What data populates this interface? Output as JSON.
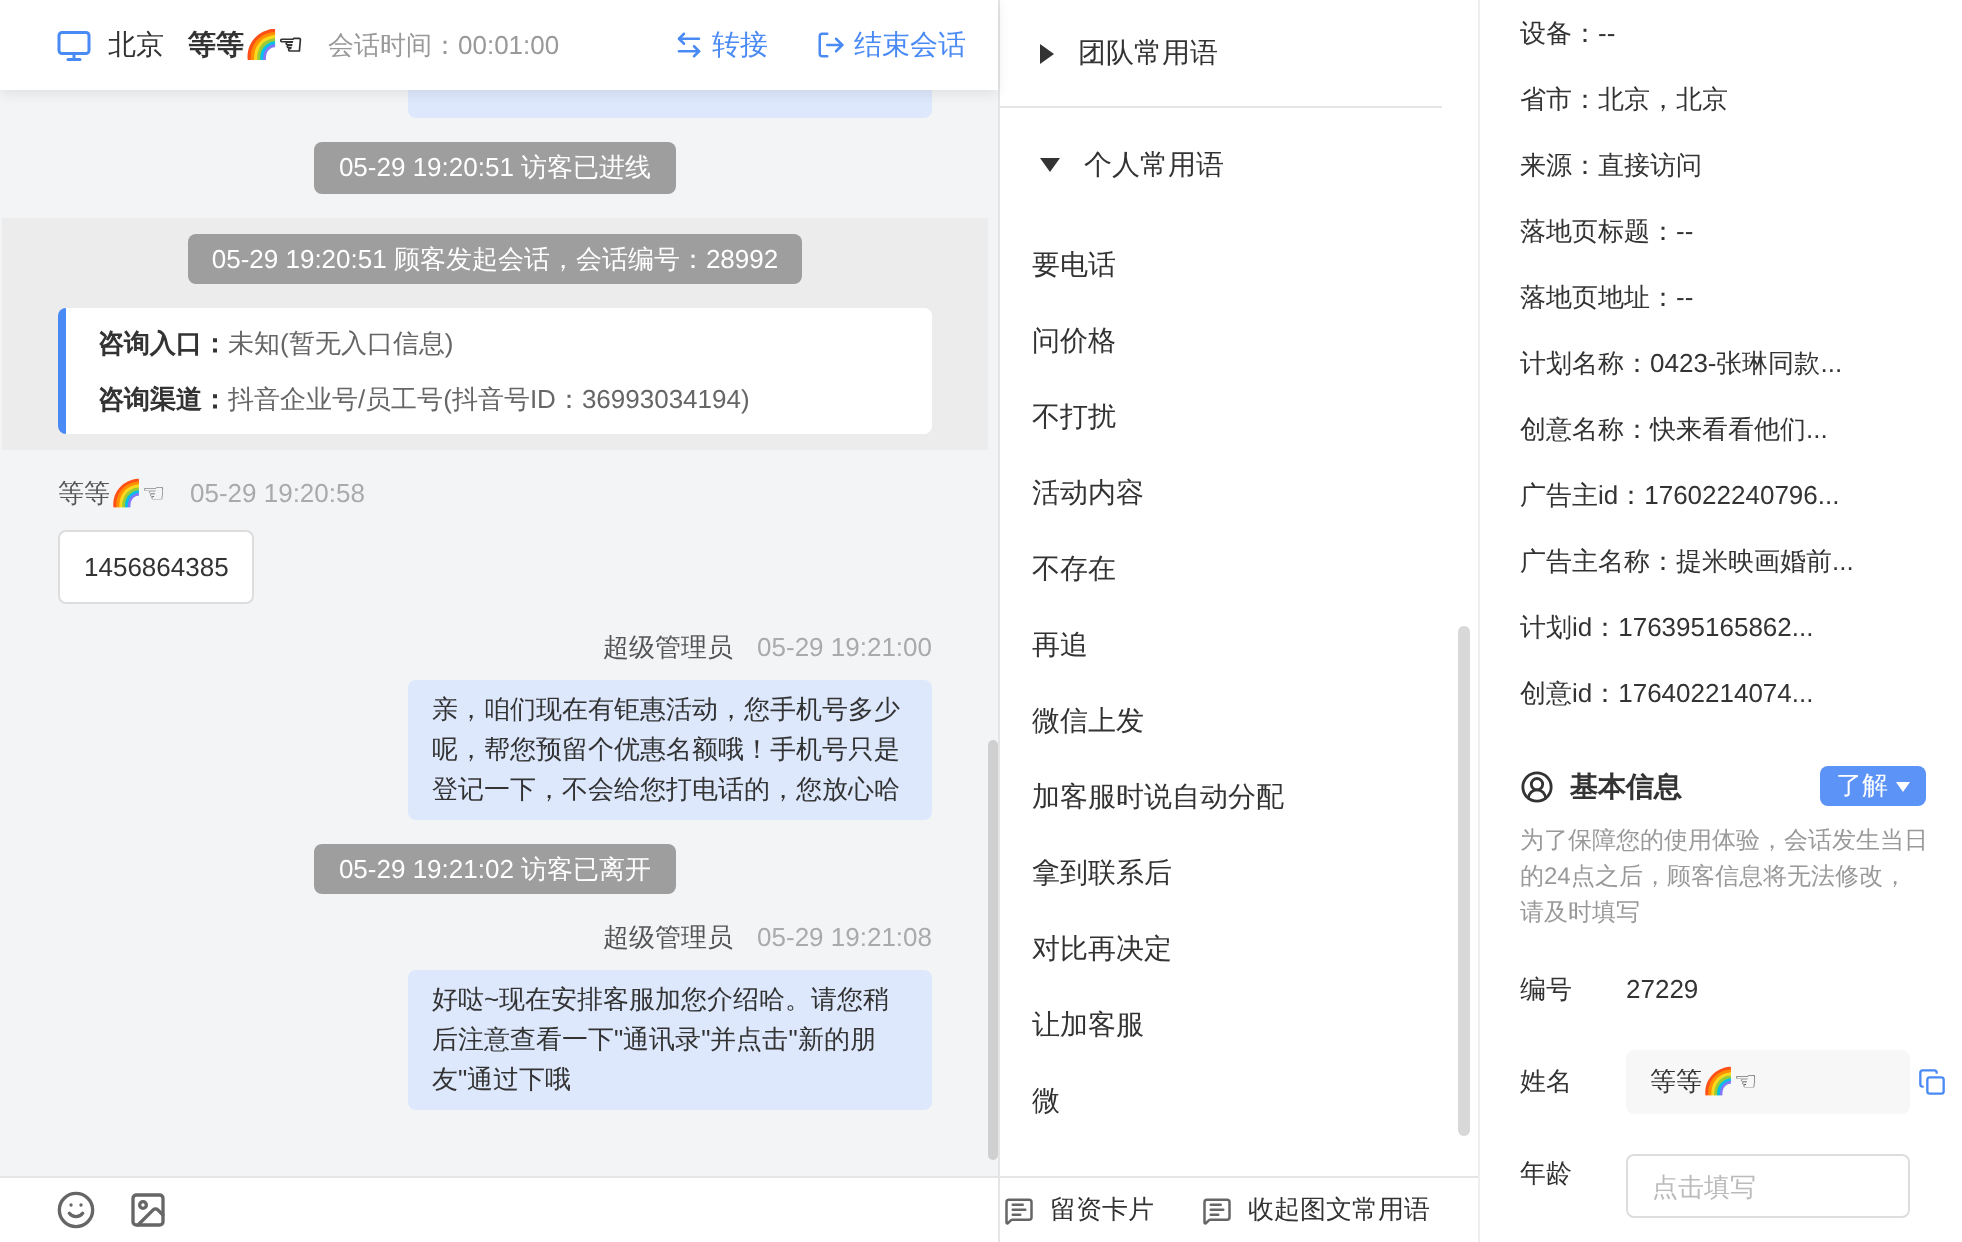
{
  "header": {
    "location": "北京",
    "visitor": "等等🌈☜",
    "duration": "会话时间：00:01:00",
    "actions": [
      {
        "kind": "transfer",
        "label": "转接"
      },
      {
        "kind": "end",
        "label": "结束会话"
      }
    ]
  },
  "messages": [
    {
      "kind": "cut"
    },
    {
      "kind": "system",
      "text": "05-29 19:20:51 访客已进线"
    },
    {
      "kind": "session",
      "notice": "05-29 19:20:51 顾客发起会话，会话编号：28992",
      "entries": [
        {
          "label": "咨询入口：",
          "value": "未知(暂无入口信息)"
        },
        {
          "label": "咨询渠道：",
          "value": "抖音企业号/员工号(抖音号ID：36993034194)"
        }
      ]
    },
    {
      "kind": "visitor",
      "name": "等等🌈☜",
      "time": "05-29 19:20:58",
      "text": "1456864385"
    },
    {
      "kind": "agent",
      "name": "超级管理员",
      "time": "05-29 19:21:00",
      "text": "亲，咱们现在有钜惠活动，您手机号多少呢，帮您预留个优惠名额哦！手机号只是登记一下，不会给您打电话的，您放心哈"
    },
    {
      "kind": "system",
      "text": "05-29 19:21:02 访客已离开"
    },
    {
      "kind": "agent",
      "name": "超级管理员",
      "time": "05-29 19:21:08",
      "text": "好哒~现在安排客服加您介绍哈。请您稍后注意查看一下\"通讯录\"并点击\"新的朋友\"通过下哦"
    }
  ],
  "phrase_sections": [
    {
      "title": "团队常用语",
      "expanded": false
    },
    {
      "title": "个人常用语",
      "expanded": true,
      "items": [
        "要电话",
        "问价格",
        "不打扰",
        "活动内容",
        "不存在",
        "再追",
        "微信上发",
        "加客服时说自动分配",
        "拿到联系后",
        "对比再决定",
        "让加客服",
        "微"
      ]
    }
  ],
  "phrase_toolbar": [
    "留资卡片",
    "收起图文常用语"
  ],
  "visitor_info": [
    "设备：--",
    "省市：北京，北京",
    "来源：直接访问",
    "落地页标题：--",
    "落地页地址：--",
    "计划名称：0423-张琳同款...",
    "创意名称：快来看看他们...",
    "广告主id：176022240796...",
    "广告主名称：提米映画婚前...",
    "计划id：176395165862...",
    "创意id：176402214074..."
  ],
  "basic_info": {
    "title": "基本信息",
    "button": "了解",
    "note": "为了保障您的使用体验，会话发生当日的24点之后，顾客信息将无法修改，请及时填写",
    "fields": [
      {
        "kind": "text",
        "label": "编号",
        "value": "27229"
      },
      {
        "kind": "readonly",
        "label": "姓名",
        "value": "等等🌈☜"
      },
      {
        "kind": "input",
        "label": "年龄",
        "placeholder": "点击填写"
      }
    ]
  }
}
